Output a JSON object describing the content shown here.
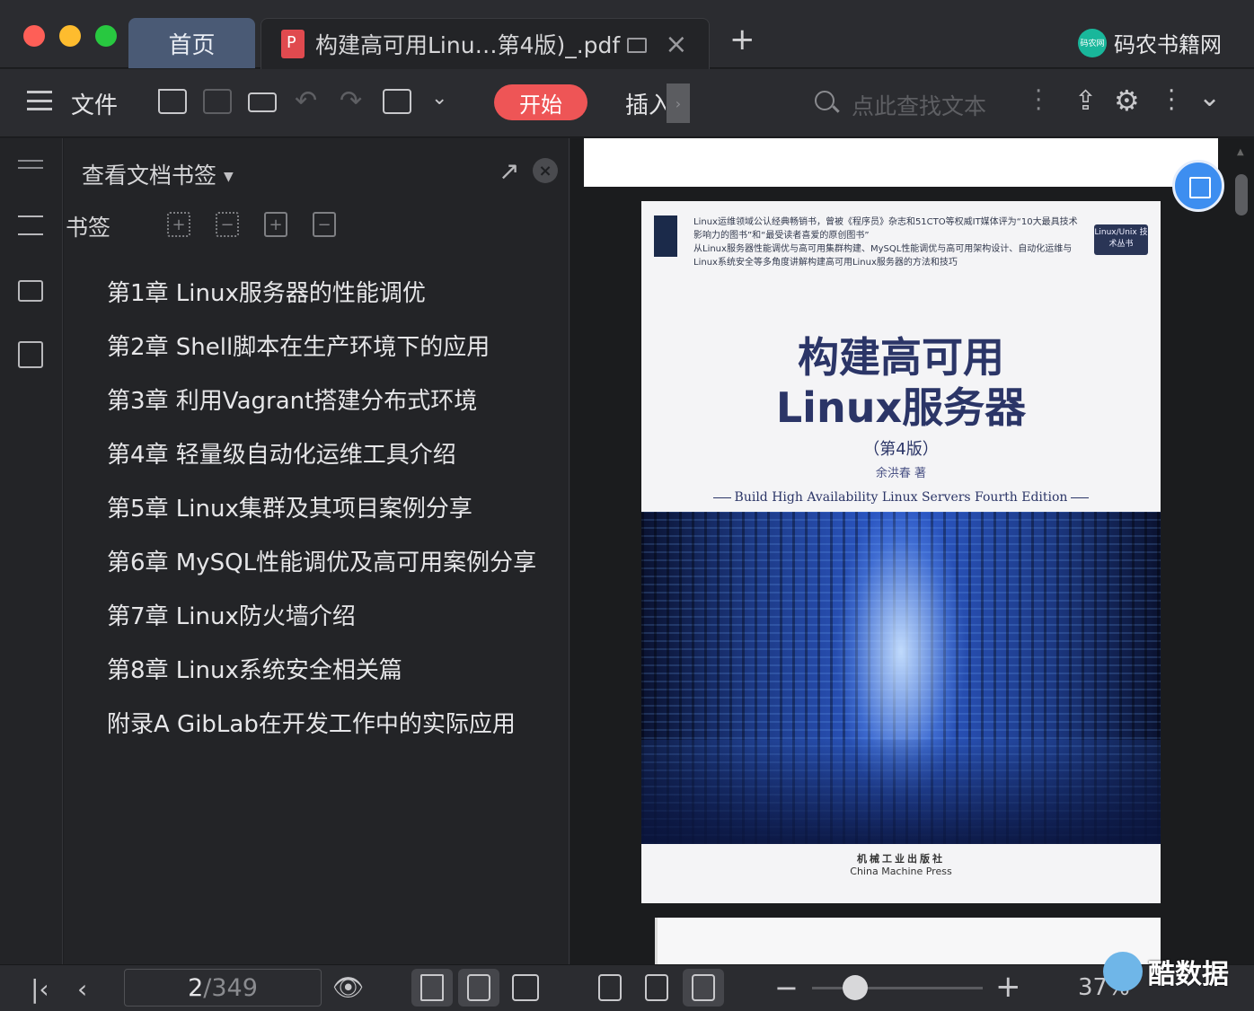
{
  "titlebar": {
    "home_tab": "首页",
    "doc_tab": "构建高可用Linu…第4版)_.pdf",
    "new_tab_icon": "plus-icon",
    "brand": "码农书籍网",
    "brand_logo_text": "码农网"
  },
  "toolbar": {
    "menu_label": "文件",
    "start_label": "开始",
    "insert_label": "插入",
    "search_placeholder": "点此查找文本"
  },
  "bookmarks": {
    "panel_title": "查看文档书签",
    "section_label": "书签",
    "items": [
      "第1章 Linux服务器的性能调优",
      "第2章 Shell脚本在生产环境下的应用",
      "第3章 利用Vagrant搭建分布式环境",
      "第4章 轻量级自动化运维工具介绍",
      "第5章 Linux集群及其项目案例分享",
      "第6章 MySQL性能调优及高可用案例分享",
      "第7章 Linux防火墙介绍",
      "第8章 Linux系统安全相关篇",
      "附录A GibLab在开发工作中的实际应用"
    ]
  },
  "cover": {
    "blurb_1": "Linux运维领域公认经典畅销书，曾被《程序员》杂志和51CTO等权威IT媒体评为“10大最具技术影响力的图书”和“最受读者喜爱的原创图书”",
    "blurb_2": "从Linux服务器性能调优与高可用集群构建、MySQL性能调优与高可用架构设计、自动化运维与Linux系统安全等多角度讲解构建高可用Linux服务器的方法和技巧",
    "series": "Linux/Unix 技术丛书",
    "title_1": "构建高可用",
    "title_2": "Linux服务器",
    "edition": "（第4版）",
    "author": "余洪春 著",
    "english_title": "Build High Availability Linux Servers Fourth Edition",
    "publisher_cn": "机械工业出版社",
    "publisher_en": "China Machine Press"
  },
  "status": {
    "current_page": "2",
    "separator": "/",
    "total_pages": "349",
    "zoom": "37%",
    "zoom_fraction": 0.25
  },
  "watermark": "酷数据"
}
